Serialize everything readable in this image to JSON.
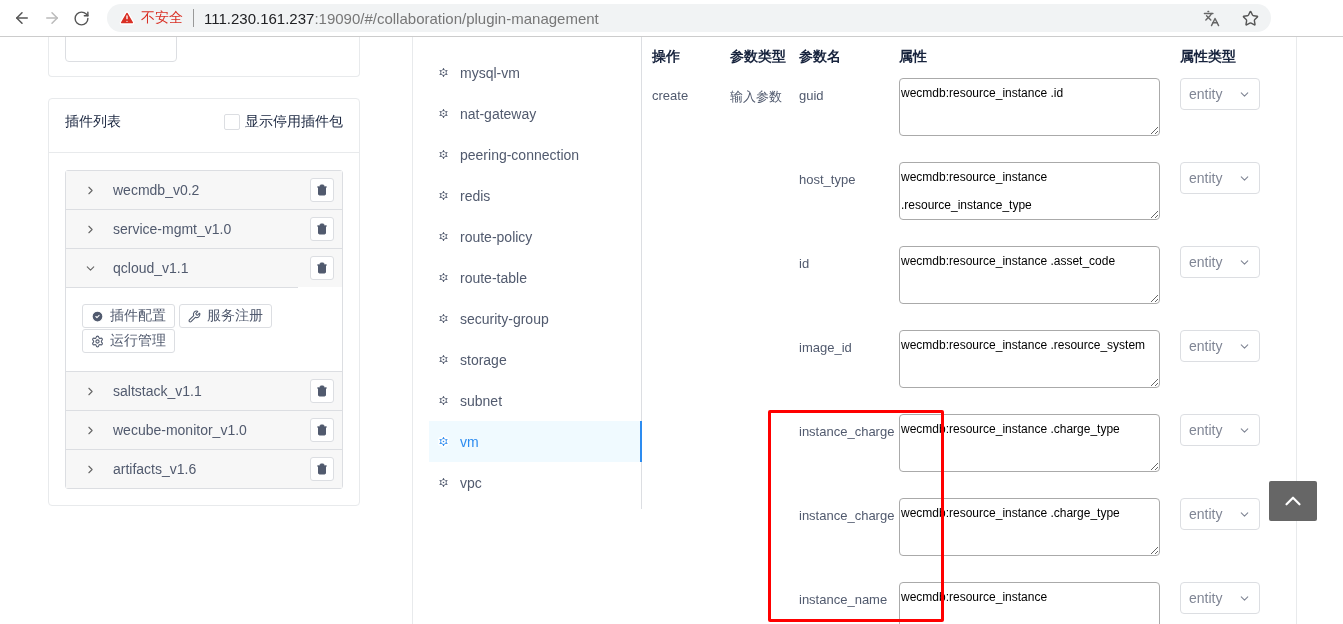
{
  "browser": {
    "forward_disabled": true,
    "security_label": "不安全",
    "url_host": "111.230.161.237",
    "url_path": ":19090/#/collaboration/plugin-management"
  },
  "plugin_panel": {
    "title": "插件列表",
    "show_disabled": {
      "label": "显示停用插件包",
      "checked": false
    },
    "plugins": [
      {
        "name": "wecmdb_v0.2",
        "expanded": false
      },
      {
        "name": "service-mgmt_v1.0",
        "expanded": false
      },
      {
        "name": "qcloud_v1.1",
        "expanded": true,
        "actions": [
          {
            "label": "插件配置",
            "kind": "check"
          },
          {
            "label": "服务注册",
            "kind": "tools"
          },
          {
            "label": "运行管理",
            "kind": "gear"
          }
        ]
      },
      {
        "name": "saltstack_v1.1",
        "expanded": false
      },
      {
        "name": "wecube-monitor_v1.0",
        "expanded": false
      },
      {
        "name": "artifacts_v1.6",
        "expanded": false
      }
    ]
  },
  "resources": [
    {
      "label": "mysql-vm",
      "selected": false
    },
    {
      "label": "nat-gateway",
      "selected": false
    },
    {
      "label": "peering-connection",
      "selected": false
    },
    {
      "label": "redis",
      "selected": false
    },
    {
      "label": "route-policy",
      "selected": false
    },
    {
      "label": "route-table",
      "selected": false
    },
    {
      "label": "security-group",
      "selected": false
    },
    {
      "label": "storage",
      "selected": false
    },
    {
      "label": "subnet",
      "selected": false
    },
    {
      "label": "vm",
      "selected": true
    },
    {
      "label": "vpc",
      "selected": false
    }
  ],
  "table": {
    "columns": [
      "操作",
      "参数类型",
      "参数名",
      "属性",
      "属性类型"
    ],
    "rows": [
      {
        "operation": "create",
        "param_type": "输入参数",
        "name": "guid",
        "value": "wecmdb:resource_instance .id",
        "attr_type": "entity"
      },
      {
        "name": "host_type",
        "value": "wecmdb:resource_instance .resource_instance_type",
        "attr_type": "entity"
      },
      {
        "name": "id",
        "value": "wecmdb:resource_instance .asset_code",
        "attr_type": "entity"
      },
      {
        "name": "image_id",
        "value": "wecmdb:resource_instance .resource_system",
        "attr_type": "entity"
      },
      {
        "name": "instance_charge",
        "value": "wecmdb:resource_instance .charge_type",
        "attr_type": "entity"
      },
      {
        "name": "instance_charge",
        "value": "wecmdb:resource_instance .charge_type",
        "attr_type": "entity"
      },
      {
        "name": "instance_name",
        "value": "wecmdb:resource_instance",
        "attr_type": "entity"
      }
    ]
  },
  "highlight_box": {
    "kind": "rectangle"
  }
}
